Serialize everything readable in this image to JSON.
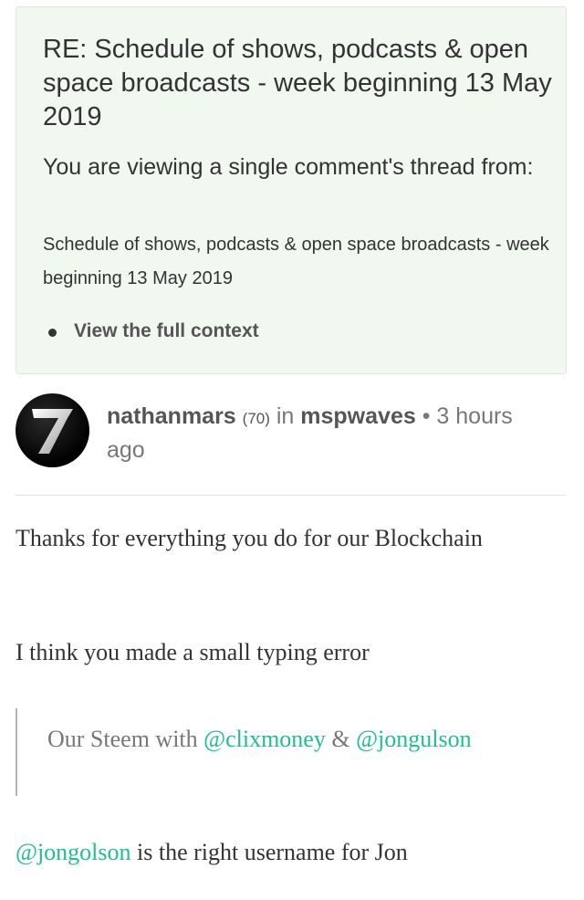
{
  "context": {
    "title": "RE: Schedule of shows, podcasts & open space broadcasts - week beginning 13 May 2019",
    "viewing_text": "You are viewing a single comment's thread from:",
    "parent_title": "Schedule of shows, podcasts & open space broadcasts - week beginning 13 May 2019",
    "full_context_link": "View the full context"
  },
  "author": {
    "avatar_label": "7",
    "name": "nathanmars",
    "reputation": "(70)",
    "in_label": "in",
    "community": "mspwaves",
    "separator": "•",
    "time_ago": "3 hours ago"
  },
  "comment": {
    "para1": "Thanks for everything you do for our Blockchain",
    "para2": "I think you made a small typing error",
    "quote": {
      "prefix": "Our Steem with ",
      "mention1": "@clixmoney",
      "amp": " & ",
      "mention2": "@jongulson"
    },
    "para3": {
      "mention": "@jongolson",
      "rest": " is the right username for Jon"
    }
  },
  "colors": {
    "context_bg": "#f0f8ef",
    "mention": "#1fbf8f",
    "quote_border": "#b3b3b3"
  }
}
